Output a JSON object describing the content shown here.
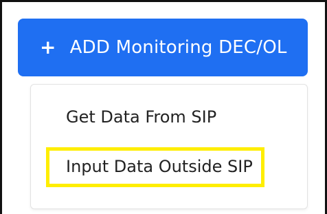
{
  "add_button": {
    "icon": "plus-icon",
    "icon_glyph": "+",
    "label": "ADD Monitoring DEC/OL",
    "color": "#1f6ff2"
  },
  "menu": {
    "items": [
      {
        "label": "Get Data From SIP"
      },
      {
        "label": "Input Data Outside SIP",
        "highlighted": true
      }
    ],
    "highlight_color": "#ffee00"
  }
}
